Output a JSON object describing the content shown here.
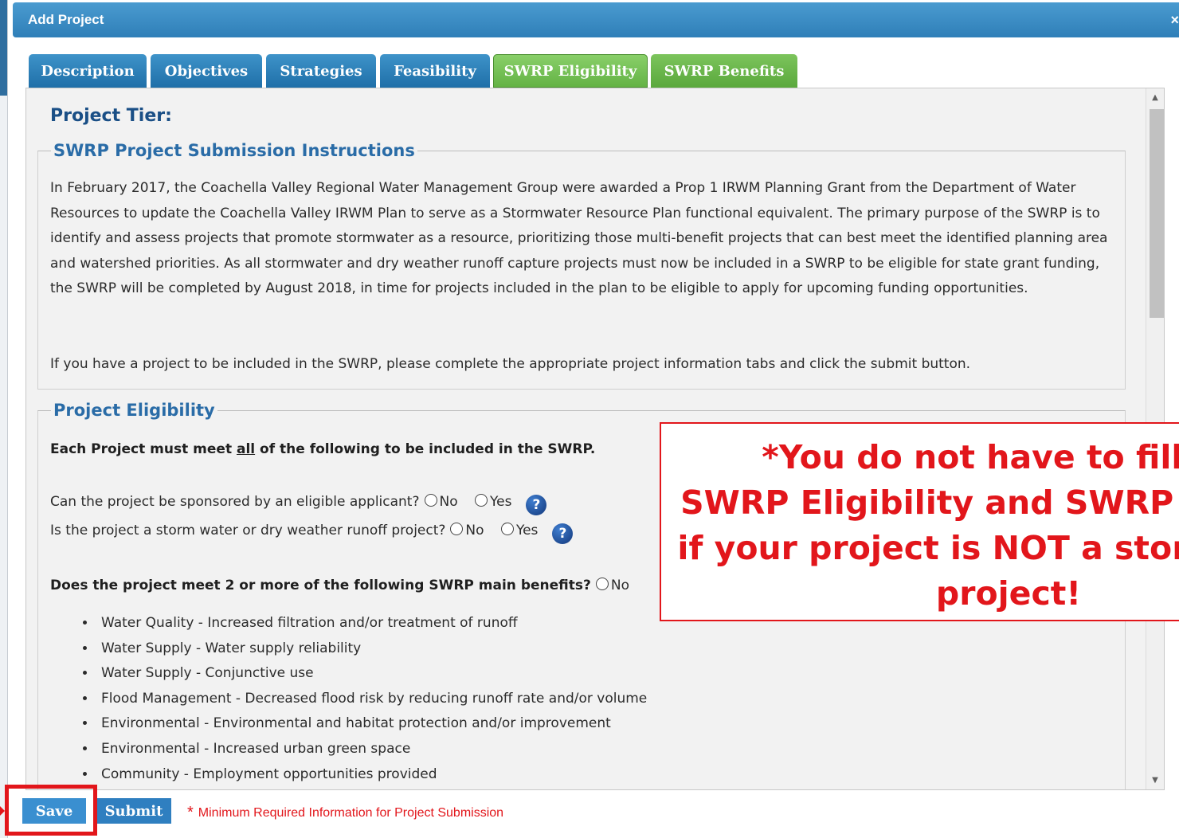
{
  "dialog": {
    "title": "Add Project",
    "close_glyph": "×"
  },
  "tabs": [
    {
      "label": "Description"
    },
    {
      "label": "Objectives"
    },
    {
      "label": "Strategies"
    },
    {
      "label": "Feasibility"
    },
    {
      "label": "SWRP Eligibility",
      "active": true
    },
    {
      "label": "SWRP Benefits"
    }
  ],
  "content": {
    "project_tier_label": "Project Tier:",
    "instructions": {
      "legend": "SWRP Project Submission Instructions",
      "paragraph1": "In February 2017, the Coachella Valley Regional Water Management Group were awarded a Prop 1 IRWM Planning Grant from the Department of Water Resources to update the Coachella Valley IRWM Plan to serve as a Stormwater Resource Plan functional equivalent. The primary purpose of the SWRP is to identify and assess projects that promote stormwater as a resource, prioritizing those multi-benefit projects that can best meet the identified planning area and watershed priorities. As all stormwater and dry weather runoff capture projects must now be included in a SWRP to be eligible for state grant funding, the SWRP will be completed by August 2018, in time for projects included in the plan to be eligible to apply for upcoming funding opportunities.",
      "paragraph2": "If you have a project to be included in the SWRP, please complete the appropriate project information tabs and click the submit button."
    },
    "eligibility": {
      "legend": "Project Eligibility",
      "intro_before": "Each Project must meet ",
      "intro_underlined": "all",
      "intro_after": " of the following to be included in the SWRP.",
      "question1": "Can the project be sponsored by an eligible applicant?",
      "question2": "Is the project a storm water or dry weather runoff project?",
      "option_no": "No",
      "option_yes": "Yes",
      "help_glyph": "?",
      "benefits_question": "Does the project meet 2 or more of the following SWRP main benefits?",
      "benefits": [
        "Water Quality - Increased filtration and/or treatment of runoff",
        "Water Supply - Water supply reliability",
        "Water Supply - Conjunctive use",
        "Flood Management - Decreased flood risk by reducing runoff rate and/or volume",
        "Environmental - Environmental and habitat protection and/or improvement",
        "Environmental - Increased urban green space",
        "Community - Employment opportunities provided"
      ]
    }
  },
  "callout": {
    "line1": "*You do not have to fill out",
    "line2": "SWRP Eligibility and SWRP Benefits",
    "line3": "if your project is NOT a storm water",
    "line4": "project!",
    "color": "#e2161b"
  },
  "footer": {
    "save_label": "Save",
    "submit_label": "Submit",
    "required_star": "*",
    "required_note": "Minimum Required Information for Project Submission"
  }
}
